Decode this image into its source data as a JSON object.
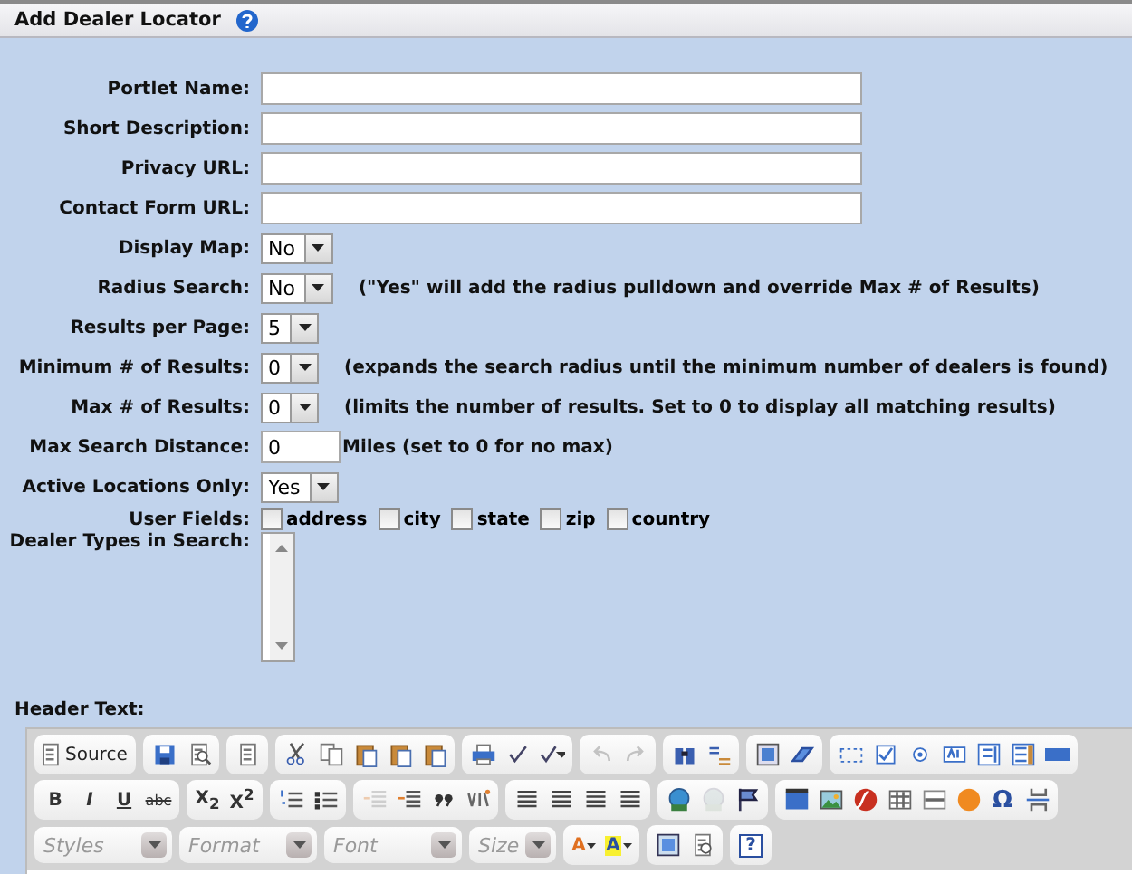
{
  "header": {
    "title": "Add Dealer Locator"
  },
  "fields": [
    {
      "kind": "text",
      "label": "Portlet Name:"
    },
    {
      "kind": "text",
      "label": "Short Description:"
    },
    {
      "kind": "text",
      "label": "Privacy URL:"
    },
    {
      "kind": "text",
      "label": "Contact Form URL:"
    },
    {
      "kind": "select",
      "label": "Display Map:",
      "value": "No"
    },
    {
      "kind": "select",
      "label": "Radius Search:",
      "value": "No",
      "note": "(\"Yes\" will add the radius pulldown and override Max # of Results)"
    },
    {
      "kind": "select",
      "label": "Results per Page:",
      "value": "5"
    },
    {
      "kind": "select",
      "label": "Minimum # of Results:",
      "value": "0",
      "note": "(expands the search radius until the minimum number of dealers is found)"
    },
    {
      "kind": "select",
      "label": "Max # of Results:",
      "value": "0",
      "note": "(limits the number of results. Set to 0 to display all matching results)"
    },
    {
      "kind": "number",
      "label": "Max Search Distance:",
      "value": "0",
      "note": "Miles (set to 0 for no max)"
    },
    {
      "kind": "select",
      "label": "Active Locations Only:",
      "value": "Yes"
    },
    {
      "kind": "checkboxes",
      "label": "User Fields:",
      "options": [
        {
          "label": "address",
          "checked": false
        },
        {
          "label": "city",
          "checked": false
        },
        {
          "label": "state",
          "checked": false
        },
        {
          "label": "zip",
          "checked": false
        },
        {
          "label": "country",
          "checked": false
        }
      ]
    },
    {
      "kind": "listbox",
      "label": "Dealer Types in Search:"
    }
  ],
  "editor": {
    "label": "Header Text:",
    "toolbar_rows": [
      [
        [
          {
            "kind": "source",
            "label": "Source",
            "disabled": false
          }
        ],
        [
          {
            "kind": "save",
            "disabled": false
          },
          {
            "kind": "preview",
            "disabled": false
          }
        ],
        [
          {
            "kind": "templates",
            "disabled": false
          }
        ],
        [
          {
            "kind": "cut",
            "disabled": false
          },
          {
            "kind": "copy",
            "disabled": false
          },
          {
            "kind": "paste",
            "disabled": false
          },
          {
            "kind": "paste-text",
            "disabled": false
          },
          {
            "kind": "paste-word",
            "disabled": false
          }
        ],
        [
          {
            "kind": "print",
            "disabled": false
          },
          {
            "kind": "spellcheck",
            "disabled": false
          },
          {
            "kind": "spellcheck-menu",
            "disabled": false
          }
        ],
        [
          {
            "kind": "undo",
            "disabled": true
          },
          {
            "kind": "redo",
            "disabled": true
          }
        ],
        [
          {
            "kind": "find",
            "disabled": false
          },
          {
            "kind": "replace",
            "disabled": false
          }
        ],
        [
          {
            "kind": "select-all",
            "disabled": false
          },
          {
            "kind": "remove-format",
            "disabled": false
          }
        ],
        [
          {
            "kind": "form",
            "disabled": false
          },
          {
            "kind": "checkbox",
            "disabled": false
          },
          {
            "kind": "radio",
            "disabled": false
          },
          {
            "kind": "textfield",
            "disabled": false
          },
          {
            "kind": "textarea",
            "disabled": false
          },
          {
            "kind": "select",
            "disabled": false
          },
          {
            "kind": "button",
            "disabled": false
          }
        ]
      ],
      [
        [
          {
            "kind": "bold",
            "label": "B",
            "disabled": false
          },
          {
            "kind": "italic",
            "label": "I",
            "disabled": false
          },
          {
            "kind": "underline",
            "label": "U",
            "disabled": false
          },
          {
            "kind": "strike",
            "label": "abc",
            "disabled": false
          }
        ],
        [
          {
            "kind": "subscript",
            "label": "X$_{2}$",
            "disabled": false
          },
          {
            "kind": "superscript",
            "label": "X$^{2}$",
            "disabled": false
          }
        ],
        [
          {
            "kind": "numbered-list",
            "disabled": false
          },
          {
            "kind": "bulleted-list",
            "disabled": false
          }
        ],
        [
          {
            "kind": "outdent",
            "disabled": true
          },
          {
            "kind": "indent",
            "disabled": false
          },
          {
            "kind": "blockquote",
            "disabled": false
          },
          {
            "kind": "div",
            "disabled": false
          }
        ],
        [
          {
            "kind": "align",
            "disabled": false
          },
          {
            "kind": "align",
            "disabled": false
          },
          {
            "kind": "align",
            "disabled": false
          },
          {
            "kind": "align",
            "disabled": false
          }
        ],
        [
          {
            "kind": "link",
            "disabled": false
          },
          {
            "kind": "unlink",
            "disabled": true
          },
          {
            "kind": "anchor",
            "disabled": false
          }
        ],
        [
          {
            "kind": "media",
            "disabled": false
          },
          {
            "kind": "image",
            "disabled": false
          },
          {
            "kind": "flash",
            "disabled": false
          },
          {
            "kind": "table",
            "disabled": false
          },
          {
            "kind": "hr",
            "disabled": false
          },
          {
            "kind": "smiley",
            "disabled": false
          },
          {
            "kind": "special-char",
            "label": "Ω",
            "disabled": false
          },
          {
            "kind": "page-break",
            "disabled": false
          }
        ]
      ],
      [
        [
          {
            "kind": "combo",
            "label": "Styles",
            "disabled": false
          }
        ],
        [
          {
            "kind": "combo",
            "label": "Format",
            "disabled": false
          }
        ],
        [
          {
            "kind": "combo",
            "label": "Font",
            "disabled": false
          }
        ],
        [
          {
            "kind": "combo-small",
            "label": "Size",
            "disabled": false
          }
        ],
        [
          {
            "kind": "text-color",
            "label": "A",
            "disabled": false
          },
          {
            "kind": "bg-color",
            "label": "A",
            "disabled": false
          }
        ],
        [
          {
            "kind": "maximize",
            "disabled": false
          },
          {
            "kind": "show-blocks",
            "disabled": false
          }
        ],
        [
          {
            "kind": "about",
            "label": "?",
            "disabled": false
          }
        ]
      ]
    ]
  }
}
